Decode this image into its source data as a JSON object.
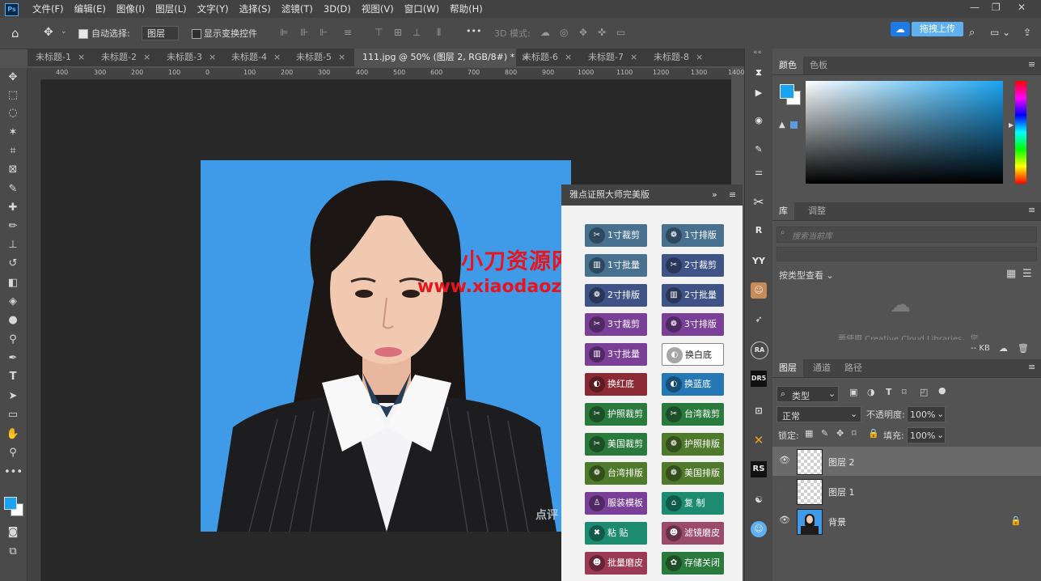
{
  "menubar": {
    "logo": "Ps",
    "items": [
      "文件(F)",
      "编辑(E)",
      "图像(I)",
      "图层(L)",
      "文字(Y)",
      "选择(S)",
      "滤镜(T)",
      "3D(D)",
      "视图(V)",
      "窗口(W)",
      "帮助(H)"
    ],
    "window_controls": [
      "—",
      "❐",
      "✕"
    ]
  },
  "options": {
    "auto_select_label": "自动选择:",
    "auto_select_checked": true,
    "auto_select_target": "图层",
    "show_transform_label": "显示变换控件",
    "more": "•••",
    "mode_3d_label": "3D 模式:",
    "upload_label": "拖拽上传"
  },
  "tabs": [
    {
      "label": "未标题-1",
      "active": false
    },
    {
      "label": "未标题-2",
      "active": false
    },
    {
      "label": "未标题-3",
      "active": false
    },
    {
      "label": "未标题-4",
      "active": false
    },
    {
      "label": "未标题-5",
      "active": false
    },
    {
      "label": "111.jpg @ 50% (图层 2, RGB/8#) *",
      "active": true
    },
    {
      "label": "未标题-6",
      "active": false
    },
    {
      "label": "未标题-7",
      "active": false
    },
    {
      "label": "未标题-8",
      "active": false
    }
  ],
  "ruler": {
    "h_labels": [
      "400",
      "300",
      "200",
      "100",
      "0",
      "100",
      "200",
      "300",
      "400",
      "500",
      "600",
      "700",
      "800",
      "900",
      "1000",
      "1100",
      "1200",
      "1300",
      "1400"
    ]
  },
  "plugin": {
    "title": "雅点证照大师完美版",
    "buttons": [
      {
        "label": "1寸裁剪",
        "icon": "scissors-icon",
        "color": "#48708f"
      },
      {
        "label": "1寸排版",
        "icon": "layout-icon",
        "color": "#48708f"
      },
      {
        "label": "1寸批量",
        "icon": "batch-icon",
        "color": "#48708f"
      },
      {
        "label": "2寸裁剪",
        "icon": "scissors-icon",
        "color": "#3f5387"
      },
      {
        "label": "2寸排版",
        "icon": "layout-icon",
        "color": "#3f5387"
      },
      {
        "label": "2寸批量",
        "icon": "batch-icon",
        "color": "#3f5387"
      },
      {
        "label": "3寸裁剪",
        "icon": "scissors-icon",
        "color": "#7a3f97"
      },
      {
        "label": "3寸排版",
        "icon": "layout-icon",
        "color": "#7a3f97"
      },
      {
        "label": "3寸批量",
        "icon": "batch-icon",
        "color": "#7a3f97"
      },
      {
        "label": "换白底",
        "icon": "bg-white-icon",
        "color": "#ffffff"
      },
      {
        "label": "换红底",
        "icon": "bg-red-icon",
        "color": "#8b2a34"
      },
      {
        "label": "换蓝底",
        "icon": "bg-blue-icon",
        "color": "#2577b5"
      },
      {
        "label": "护照裁剪",
        "icon": "scissors-icon",
        "color": "#2b7a3d"
      },
      {
        "label": "台湾裁剪",
        "icon": "scissors-icon",
        "color": "#2b7a3d"
      },
      {
        "label": "美国裁剪",
        "icon": "scissors-icon",
        "color": "#2b7a3d"
      },
      {
        "label": "护照排版",
        "icon": "layout-icon",
        "color": "#4f7a2c"
      },
      {
        "label": "台湾排版",
        "icon": "layout-icon",
        "color": "#4f7a2c"
      },
      {
        "label": "美国排版",
        "icon": "layout-icon",
        "color": "#4f7a2c"
      },
      {
        "label": "服装模板",
        "icon": "clothes-icon",
        "color": "#7a3f97"
      },
      {
        "label": "复  制",
        "icon": "copy-icon",
        "color": "#1d8b70"
      },
      {
        "label": "粘  贴",
        "icon": "paste-icon",
        "color": "#1d8b70"
      },
      {
        "label": "滤镜磨皮",
        "icon": "smooth-icon",
        "color": "#9b4a6a"
      },
      {
        "label": "批量磨皮",
        "icon": "smooth-icon",
        "color": "#9b3a55"
      },
      {
        "label": "存储关闭",
        "icon": "save-icon",
        "color": "#2b7a3d"
      }
    ]
  },
  "watermark": {
    "line1": "小刀资源网",
    "line2": "www.xiaodaozy.com",
    "corner": "点评"
  },
  "color_panel": {
    "tabs": [
      "颜色",
      "色板"
    ],
    "foreground": "#1aa3f0",
    "background": "#ffffff",
    "accent": "#1aa3f0"
  },
  "library_panel": {
    "tabs": [
      "库",
      "调整"
    ],
    "search_placeholder": "搜索当前库",
    "view_by": "按类型查看",
    "info": "要使用 Creative Cloud Libraries，您",
    "size": "-- KB"
  },
  "layers_panel": {
    "tabs": [
      "图层",
      "通道",
      "路径"
    ],
    "filter_label": "类型",
    "blend_mode": "正常",
    "opacity_label": "不透明度:",
    "opacity_value": "100%",
    "lock_label": "锁定:",
    "fill_label": "填充:",
    "fill_value": "100%",
    "layers": [
      {
        "name": "图层 2",
        "visible": true,
        "selected": true
      },
      {
        "name": "图层 1",
        "visible": false,
        "selected": false
      },
      {
        "name": "背景",
        "visible": true,
        "selected": false,
        "locked": true
      }
    ]
  },
  "strip_icons": [
    "R",
    "YY",
    "RA",
    "DR5",
    "RS"
  ]
}
